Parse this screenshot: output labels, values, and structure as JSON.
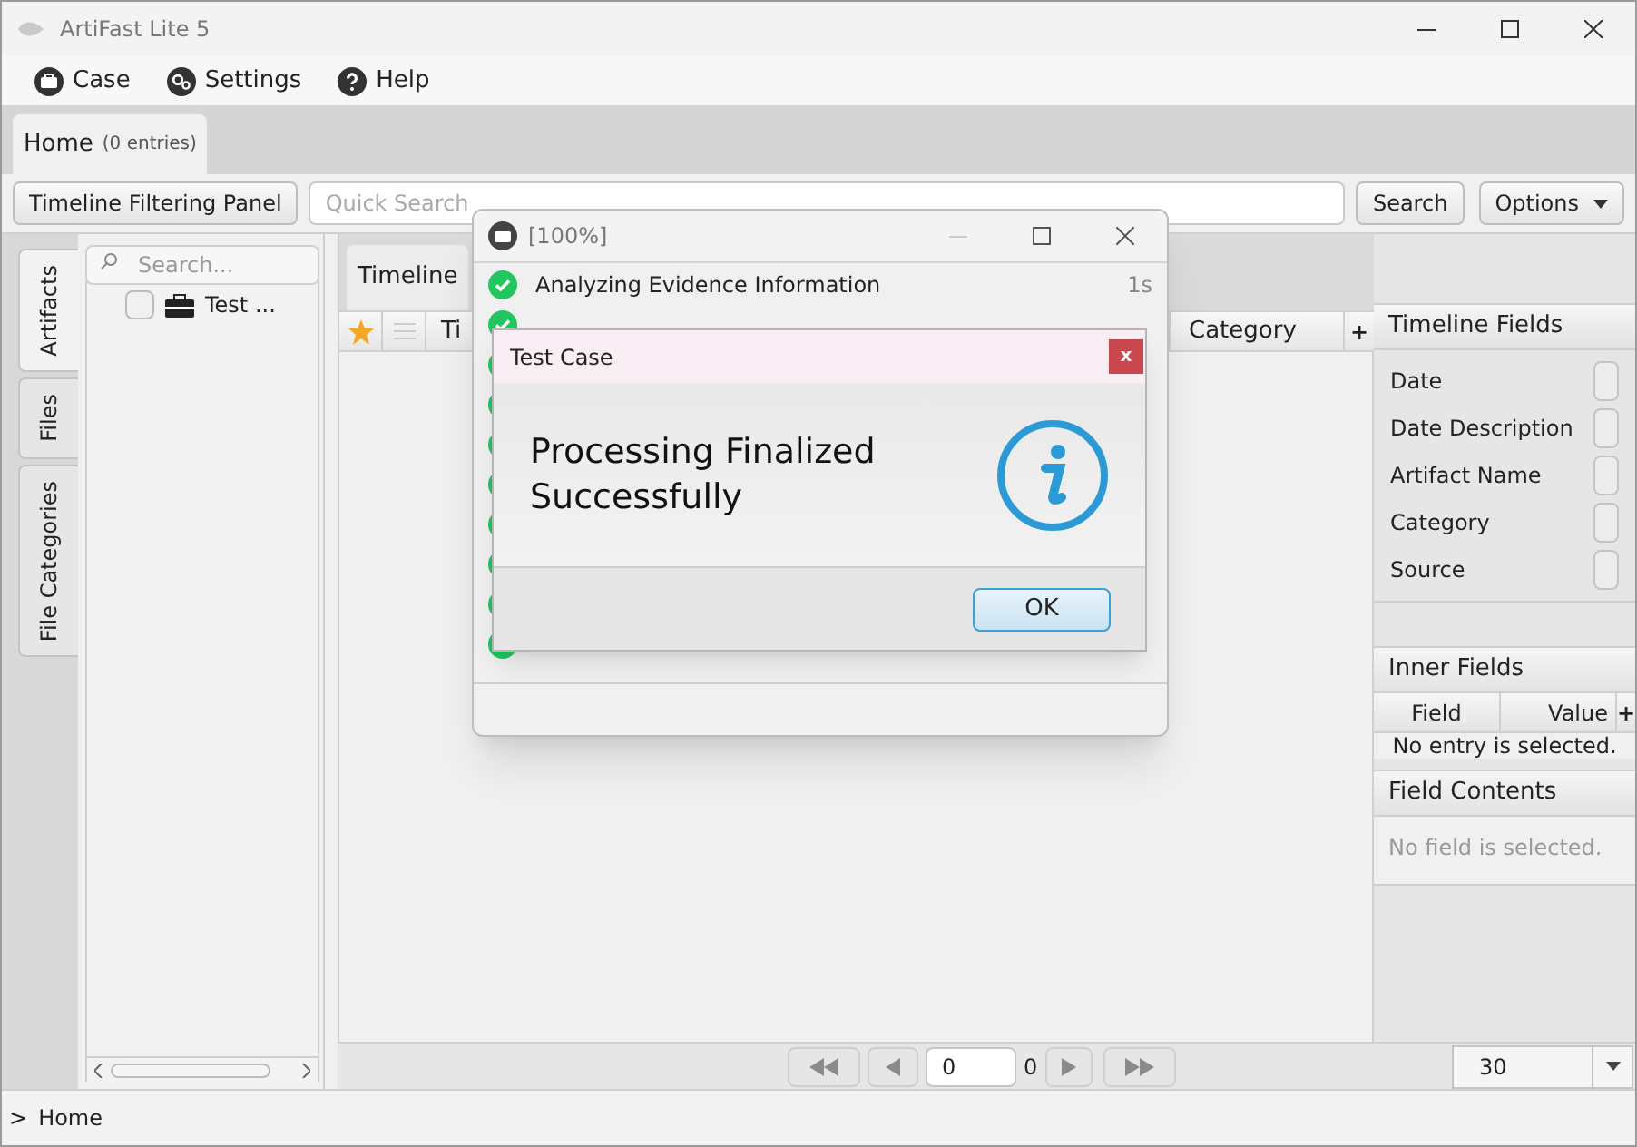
{
  "window": {
    "title": "ArtiFast Lite 5"
  },
  "menu": [
    {
      "label": "Case"
    },
    {
      "label": "Settings"
    },
    {
      "label": "Help"
    }
  ],
  "tabs": [
    {
      "label": "Home",
      "count": "(0 entries)",
      "selected": true
    }
  ],
  "toolbar": {
    "filter_button": "Timeline Filtering Panel",
    "search": {
      "placeholder": "Quick Search"
    },
    "search_button": "Search",
    "options_button": "Options"
  },
  "side_tabs": [
    {
      "label": "Artifacts",
      "selected": true
    },
    {
      "label": "Files",
      "selected": false
    },
    {
      "label": "File Categories",
      "selected": false
    }
  ],
  "tree": {
    "search": {
      "placeholder": "Search..."
    },
    "items": [
      {
        "label": "Test ...",
        "checked": false
      }
    ]
  },
  "timeline": {
    "tab": "Timeline",
    "columns": [
      "Ti",
      "Category"
    ],
    "add": "+"
  },
  "pager": {
    "page": "0",
    "total": "0",
    "page_size": "30"
  },
  "timeline_fields": {
    "title": "Timeline Fields",
    "fields": [
      {
        "label": "Date",
        "checked": false
      },
      {
        "label": "Date Description",
        "checked": false
      },
      {
        "label": "Artifact Name",
        "checked": false
      },
      {
        "label": "Category",
        "checked": false
      },
      {
        "label": "Source",
        "checked": false
      }
    ]
  },
  "inner_fields": {
    "title": "Inner Fields",
    "columns": [
      "Field",
      "Value"
    ],
    "add": "+",
    "empty": "No entry is selected."
  },
  "field_contents": {
    "title": "Field Contents",
    "empty": "No field is selected."
  },
  "status_bar": {
    "marker": ">",
    "path": "Home"
  },
  "progress_dialog": {
    "title": "[100%]",
    "steps": [
      {
        "label": "Analyzing Evidence Information",
        "time": "1s",
        "done": true
      },
      {
        "done": true
      },
      {
        "done": true
      },
      {
        "done": true
      },
      {
        "done": true
      },
      {
        "done": true
      },
      {
        "done": true
      },
      {
        "done": true
      },
      {
        "done": true
      },
      {
        "done": true
      }
    ]
  },
  "message_dialog": {
    "title": "Test Case",
    "close": "x",
    "message": "Processing Finalized Successfully",
    "buttons": [
      "OK"
    ]
  }
}
